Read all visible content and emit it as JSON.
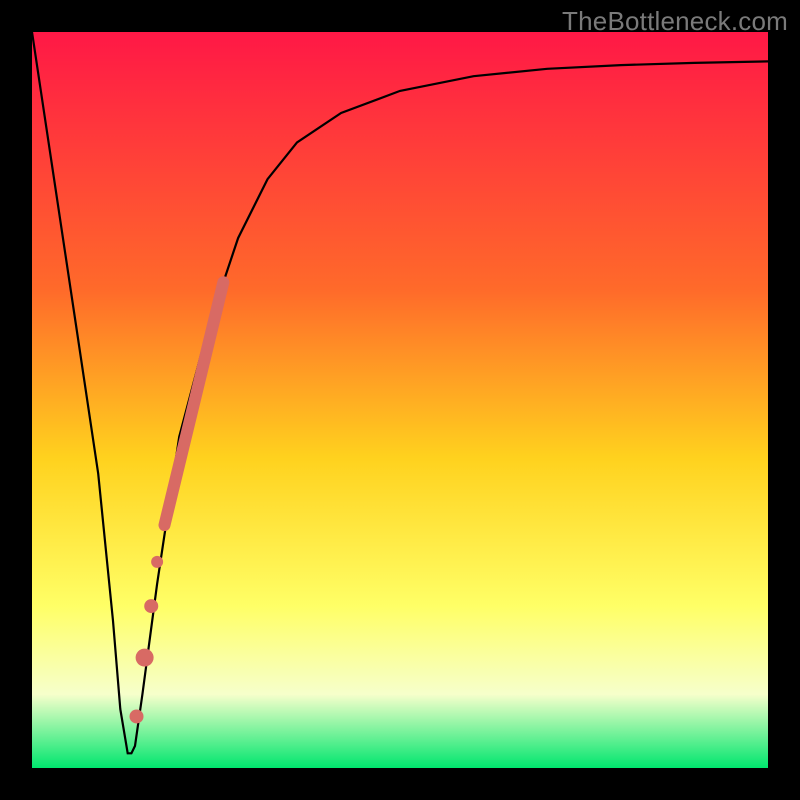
{
  "watermark": "TheBottleneck.com",
  "colors": {
    "frame": "#000000",
    "gradient_top": "#ff1846",
    "gradient_mid1": "#ff6a2a",
    "gradient_mid2": "#ffd21e",
    "gradient_mid3": "#ffff66",
    "gradient_mid4": "#f6ffcb",
    "gradient_bottom": "#00e66e",
    "curve": "#000000",
    "marker": "#d86a64"
  },
  "chart_data": {
    "type": "line",
    "title": "",
    "xlabel": "",
    "ylabel": "",
    "xlim": [
      0,
      100
    ],
    "ylim": [
      0,
      100
    ],
    "series": [
      {
        "name": "bottleneck-curve",
        "x": [
          0,
          3,
          6,
          9,
          11,
          12,
          13,
          13.5,
          14,
          15,
          17,
          20,
          24,
          28,
          32,
          36,
          42,
          50,
          60,
          70,
          80,
          90,
          100
        ],
        "y": [
          100,
          80,
          60,
          40,
          20,
          8,
          2,
          2,
          3,
          10,
          25,
          45,
          60,
          72,
          80,
          85,
          89,
          92,
          94,
          95,
          95.5,
          95.8,
          96
        ]
      }
    ],
    "markers": [
      {
        "name": "thick-segment",
        "type": "line",
        "x": [
          18,
          26
        ],
        "y": [
          33,
          66
        ],
        "width": 12
      },
      {
        "name": "dot-1",
        "type": "point",
        "x": 17.0,
        "y": 28,
        "r": 6
      },
      {
        "name": "dot-2",
        "type": "point",
        "x": 16.2,
        "y": 22,
        "r": 7
      },
      {
        "name": "dot-3",
        "type": "point",
        "x": 15.3,
        "y": 15,
        "r": 9
      },
      {
        "name": "dot-4",
        "type": "point",
        "x": 14.2,
        "y": 7,
        "r": 7
      }
    ]
  }
}
